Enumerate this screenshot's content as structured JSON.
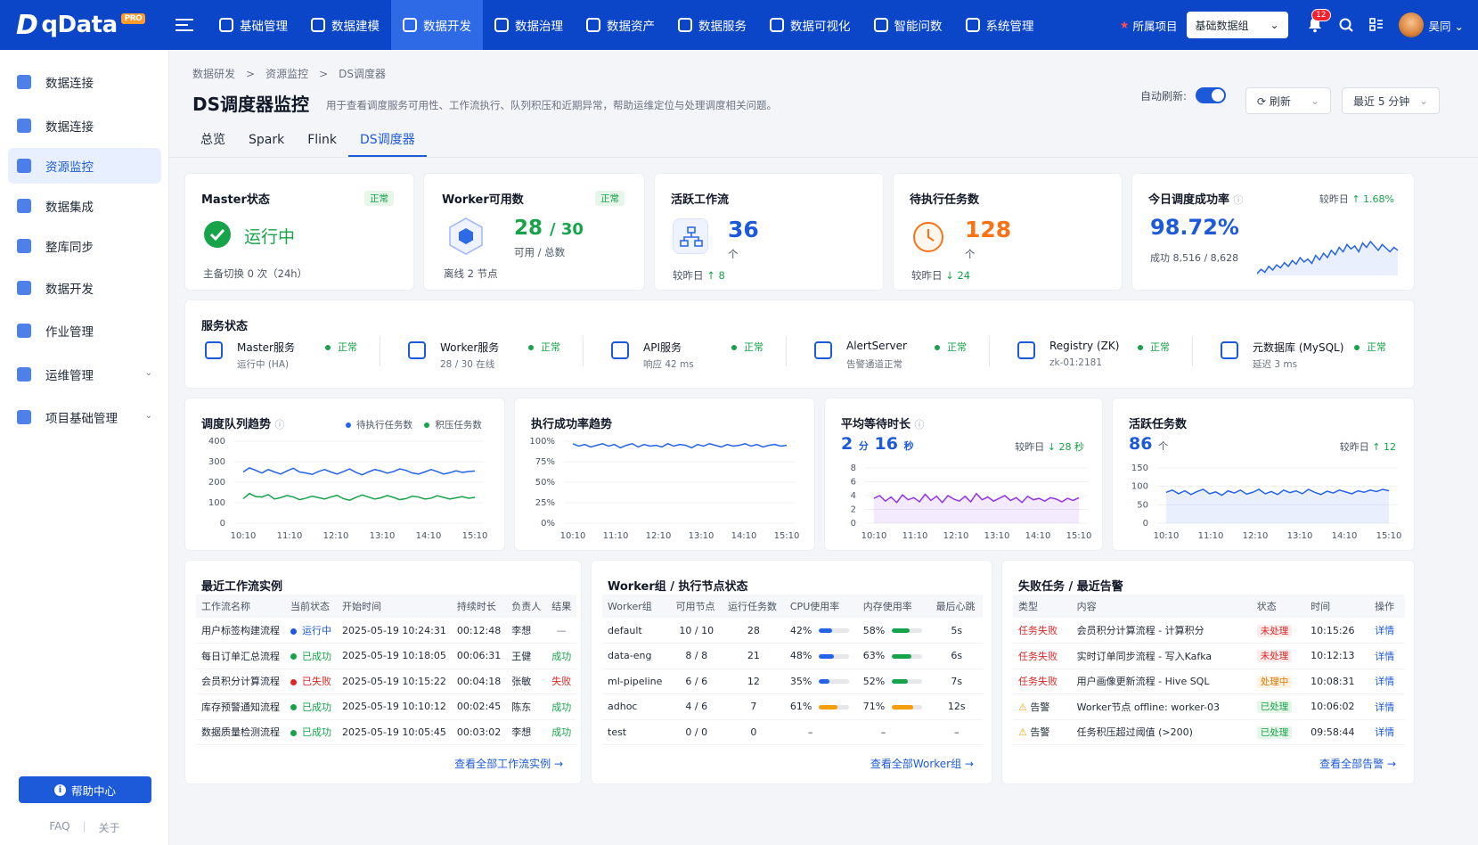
{
  "app": {
    "name": "qData",
    "badge": "PRO"
  },
  "topnav": [
    {
      "label": "基础管理",
      "icon": "gear-box-icon"
    },
    {
      "label": "数据建模",
      "icon": "book-icon"
    },
    {
      "label": "数据开发",
      "icon": "settings-cube-icon",
      "active": true
    },
    {
      "label": "数据治理",
      "icon": "layers-icon"
    },
    {
      "label": "数据资产",
      "icon": "target-icon"
    },
    {
      "label": "数据服务",
      "icon": "service-gear-icon"
    },
    {
      "label": "数据可视化",
      "icon": "monitor-icon"
    },
    {
      "label": "智能问数",
      "icon": "chart-search-icon"
    },
    {
      "label": "系统管理",
      "icon": "system-gear-icon"
    }
  ],
  "topright": {
    "project_label": "所属项目",
    "project_value": "基础数据组",
    "notif_count": "12",
    "user": "吴同"
  },
  "sidebar": {
    "items": [
      {
        "label": "数据连接",
        "icon": "network-icon"
      },
      {
        "label": "数据连接",
        "icon": "database-link-icon"
      },
      {
        "label": "资源监控",
        "icon": "cloud-monitor-icon",
        "active": true
      },
      {
        "label": "数据集成",
        "icon": "integration-icon"
      },
      {
        "label": "整库同步",
        "icon": "sync-icon"
      },
      {
        "label": "数据开发",
        "icon": "dev-stack-icon"
      },
      {
        "label": "作业管理",
        "icon": "job-icon"
      },
      {
        "label": "运维管理",
        "icon": "ops-cloud-icon",
        "expandable": true
      },
      {
        "label": "项目基础管理",
        "icon": "project-icon",
        "expandable": true
      }
    ],
    "help": "帮助中心",
    "faq": "FAQ",
    "sep": "|",
    "about": "关于"
  },
  "breadcrumb": [
    "数据研发",
    ">",
    "资源监控",
    ">",
    "DS调度器"
  ],
  "page": {
    "title": "DS调度器监控",
    "desc": "用于查看调度服务可用性、工作流执行、队列积压和近期异常，帮助运维定位与处理调度相关问题。",
    "auto_refresh": "自动刷新:",
    "refresh": "刷新",
    "range": "最近 5 分钟"
  },
  "tabs": [
    "总览",
    "Spark",
    "Flink",
    "DS调度器"
  ],
  "kpi": {
    "master": {
      "title": "Master状态",
      "badge": "正常",
      "value": "运行中",
      "sub": "主备切换 0 次（24h）"
    },
    "worker": {
      "title": "Worker可用数",
      "badge": "正常",
      "value": "28",
      "total": "/ 30",
      "unit": "可用 / 总数",
      "sub": "离线 2 节点"
    },
    "workflow": {
      "title": "活跃工作流",
      "value": "36",
      "unit": "个",
      "cmp": "较昨日",
      "delta": "↑ 8"
    },
    "pending": {
      "title": "待执行任务数",
      "value": "128",
      "unit": "个",
      "cmp": "较昨日",
      "delta": "↓ 24"
    },
    "success": {
      "title": "今日调度成功率",
      "cmp": "较昨日",
      "delta": "↑ 1.68%",
      "value": "98.72%",
      "sub": "成功 8,516 / 8,628"
    }
  },
  "services": {
    "title": "服务状态",
    "items": [
      {
        "name": "Master服务",
        "sub": "运行中 (HA)",
        "status": "正常",
        "icon": "cube-icon"
      },
      {
        "name": "Worker服务",
        "sub": "28 / 30 在线",
        "status": "正常",
        "icon": "cube-icon"
      },
      {
        "name": "API服务",
        "sub": "响应 42 ms",
        "status": "正常",
        "icon": "cube-icon"
      },
      {
        "name": "AlertServer",
        "sub": "告警通道正常",
        "status": "正常",
        "icon": "layers-icon"
      },
      {
        "name": "Registry (ZK)",
        "sub": "zk-01:2181",
        "status": "正常",
        "icon": "registry-icon"
      },
      {
        "name": "元数据库 (MySQL)",
        "sub": "延迟 3 ms",
        "status": "正常",
        "icon": "database-icon"
      }
    ]
  },
  "charts": {
    "queue": {
      "title": "调度队列趋势",
      "legend": [
        "待执行任务数",
        "积压任务数"
      ]
    },
    "exec": {
      "title": "执行成功率趋势"
    },
    "wait": {
      "title": "平均等待时长",
      "v1": "2",
      "u1": "分",
      "v2": "16",
      "u2": "秒",
      "cmp": "较昨日",
      "delta": "↓ 28 秒"
    },
    "active": {
      "title": "活跃任务数",
      "value": "86",
      "unit": "个",
      "cmp": "较昨日",
      "delta": "↑ 12"
    }
  },
  "chart_data": [
    {
      "type": "line",
      "title": "调度队列趋势",
      "x": [
        "10:10",
        "11:10",
        "12:10",
        "13:10",
        "14:10",
        "15:10"
      ],
      "ylim": [
        0,
        400
      ],
      "yticks": [
        0,
        100,
        200,
        300,
        400
      ],
      "series": [
        {
          "name": "待执行任务数",
          "color": "#2563eb",
          "values": [
            250,
            270,
            258,
            245,
            262,
            250,
            240,
            255,
            268,
            250,
            245,
            238,
            252,
            262,
            250,
            240,
            252,
            265,
            248,
            236,
            250,
            262,
            255,
            244,
            252,
            265,
            258,
            245,
            240,
            250,
            262,
            252,
            240,
            246,
            256,
            248,
            252,
            255
          ]
        },
        {
          "name": "积压任务数",
          "color": "#16a34a",
          "values": [
            120,
            145,
            130,
            128,
            140,
            118,
            125,
            135,
            128,
            115,
            122,
            132,
            125,
            118,
            128,
            136,
            120,
            112,
            126,
            138,
            128,
            118,
            124,
            135,
            126,
            115,
            120,
            132,
            128,
            118,
            122,
            134,
            126,
            118,
            124,
            130,
            122,
            126
          ]
        }
      ]
    },
    {
      "type": "line",
      "title": "执行成功率趋势",
      "x": [
        "10:10",
        "11:10",
        "12:10",
        "13:10",
        "14:10",
        "15:10"
      ],
      "ylim": [
        0,
        100
      ],
      "yticks": [
        "0%",
        "25%",
        "50%",
        "75%",
        "100%"
      ],
      "series": [
        {
          "color": "#2563eb",
          "values": [
            97,
            94,
            96,
            93,
            95,
            97,
            94,
            96,
            92,
            95,
            97,
            93,
            96,
            94,
            95,
            93,
            97,
            94,
            96,
            95,
            92,
            96,
            94,
            97,
            95,
            93,
            96,
            94,
            95,
            97,
            94,
            96,
            93,
            95,
            96,
            94,
            95
          ]
        }
      ]
    },
    {
      "type": "area",
      "title": "平均等待时长",
      "x": [
        "10:10",
        "11:10",
        "12:10",
        "13:10",
        "14:10",
        "15:10"
      ],
      "ylim": [
        0,
        8
      ],
      "yticks": [
        0,
        2,
        4,
        6,
        8
      ],
      "series": [
        {
          "color": "#9333ea",
          "values": [
            3.6,
            4.0,
            3.2,
            3.8,
            3.0,
            4.1,
            3.4,
            3.7,
            3.1,
            4.2,
            3.3,
            3.9,
            3.0,
            4.0,
            3.5,
            3.2,
            3.9,
            3.1,
            4.3,
            3.4,
            3.8,
            3.2,
            3.6,
            4.0,
            3.3,
            3.7,
            3.0,
            3.9,
            3.4,
            3.6,
            3.2,
            3.7,
            3.5,
            3.1,
            3.6,
            3.3,
            3.7
          ]
        }
      ]
    },
    {
      "type": "area",
      "title": "活跃任务数",
      "x": [
        "10:10",
        "11:10",
        "12:10",
        "13:10",
        "14:10",
        "15:10"
      ],
      "ylim": [
        0,
        150
      ],
      "yticks": [
        0,
        50,
        100,
        150
      ],
      "series": [
        {
          "color": "#2563eb",
          "values": [
            84,
            90,
            80,
            88,
            78,
            86,
            92,
            80,
            85,
            76,
            88,
            82,
            90,
            79,
            84,
            92,
            80,
            86,
            78,
            90,
            83,
            88,
            80,
            92,
            84,
            78,
            87,
            82,
            90,
            85,
            80,
            88,
            84,
            90,
            86,
            92,
            88
          ]
        }
      ]
    },
    {
      "type": "area",
      "title": "今日调度成功率",
      "x": [],
      "series": [
        {
          "color": "#2563eb",
          "values": [
            20,
            26,
            22,
            30,
            25,
            32,
            28,
            35,
            30,
            38,
            33,
            42,
            36,
            40,
            34,
            45,
            39,
            48,
            42,
            52,
            46,
            56,
            50,
            60,
            54,
            58,
            50,
            62,
            56,
            64,
            58,
            52,
            60,
            55,
            50,
            56,
            52
          ]
        }
      ]
    }
  ],
  "workflows": {
    "title": "最近工作流实例",
    "headers": [
      "工作流名称",
      "当前状态",
      "开始时间",
      "持续时长",
      "负责人",
      "结果"
    ],
    "rows": [
      {
        "name": "用户标签构建流程",
        "status": "运行中",
        "color": "#1d5ad9",
        "start": "2025-05-19 10:24:31",
        "dur": "00:12:48",
        "owner": "李想",
        "result": "—",
        "rcolor": "#6b7280"
      },
      {
        "name": "每日订单汇总流程",
        "status": "已成功",
        "color": "#16a34a",
        "start": "2025-05-19 10:18:05",
        "dur": "00:06:31",
        "owner": "王健",
        "result": "成功",
        "rcolor": "#16a34a"
      },
      {
        "name": "会员积分计算流程",
        "status": "已失败",
        "color": "#dc2626",
        "start": "2025-05-19 10:15:22",
        "dur": "00:04:18",
        "owner": "张敏",
        "result": "失败",
        "rcolor": "#dc2626"
      },
      {
        "name": "库存预警通知流程",
        "status": "已成功",
        "color": "#16a34a",
        "start": "2025-05-19 10:10:12",
        "dur": "00:02:45",
        "owner": "陈东",
        "result": "成功",
        "rcolor": "#16a34a"
      },
      {
        "name": "数据质量检测流程",
        "status": "已成功",
        "color": "#16a34a",
        "start": "2025-05-19 10:05:45",
        "dur": "00:03:02",
        "owner": "李想",
        "result": "成功",
        "rcolor": "#16a34a"
      }
    ],
    "more": "查看全部工作流实例 →"
  },
  "workers": {
    "title": "Worker组 / 执行节点状态",
    "headers": [
      "Worker组",
      "可用节点",
      "运行任务数",
      "CPU使用率",
      "内存使用率",
      "最后心跳"
    ],
    "rows": [
      {
        "group": "default",
        "nodes": "10 / 10",
        "tasks": "28",
        "cpu": "42%",
        "cpuv": 0.42,
        "cpuc": "#2563eb",
        "mem": "58%",
        "memv": 0.58,
        "memc": "#16a34a",
        "hb": "5s"
      },
      {
        "group": "data-eng",
        "nodes": "8 / 8",
        "tasks": "21",
        "cpu": "48%",
        "cpuv": 0.48,
        "cpuc": "#2563eb",
        "mem": "63%",
        "memv": 0.63,
        "memc": "#16a34a",
        "hb": "6s"
      },
      {
        "group": "ml-pipeline",
        "nodes": "6 / 6",
        "tasks": "12",
        "cpu": "35%",
        "cpuv": 0.35,
        "cpuc": "#2563eb",
        "mem": "52%",
        "memv": 0.52,
        "memc": "#16a34a",
        "hb": "7s"
      },
      {
        "group": "adhoc",
        "nodes": "4 / 6",
        "tasks": "7",
        "cpu": "61%",
        "cpuv": 0.61,
        "cpuc": "#f59e0b",
        "mem": "71%",
        "memv": 0.71,
        "memc": "#f59e0b",
        "hb": "12s"
      },
      {
        "group": "test",
        "nodes": "0 / 0",
        "tasks": "0",
        "cpu": "–",
        "cpuv": null,
        "mem": "–",
        "memv": null,
        "hb": "–"
      }
    ],
    "more": "查看全部Worker组 →"
  },
  "alerts": {
    "title": "失败任务 / 最近告警",
    "headers": [
      "类型",
      "内容",
      "状态",
      "时间",
      "操作"
    ],
    "rows": [
      {
        "type": "任务失败",
        "warn": false,
        "content": "会员积分计算流程 - 计算积分",
        "status": "未处理",
        "sc": "#dc2626",
        "sb": "#fdecec",
        "time": "10:15:26",
        "op": "详情"
      },
      {
        "type": "任务失败",
        "warn": false,
        "content": "实时订单同步流程 - 写入Kafka",
        "status": "未处理",
        "sc": "#dc2626",
        "sb": "#fdecec",
        "time": "10:12:13",
        "op": "详情"
      },
      {
        "type": "任务失败",
        "warn": false,
        "content": "用户画像更新流程 - Hive SQL",
        "status": "处理中",
        "sc": "#d97706",
        "sb": "#fef3e2",
        "time": "10:08:31",
        "op": "详情"
      },
      {
        "type": "告警",
        "warn": true,
        "content": "Worker节点 offline: worker-03",
        "status": "已处理",
        "sc": "#16a34a",
        "sb": "#e6f7ea",
        "time": "10:06:02",
        "op": "详情"
      },
      {
        "type": "告警",
        "warn": true,
        "content": "任务积压超过阈值 (>200)",
        "status": "已处理",
        "sc": "#16a34a",
        "sb": "#e6f7ea",
        "time": "09:58:44",
        "op": "详情"
      }
    ],
    "more": "查看全部告警 →"
  }
}
